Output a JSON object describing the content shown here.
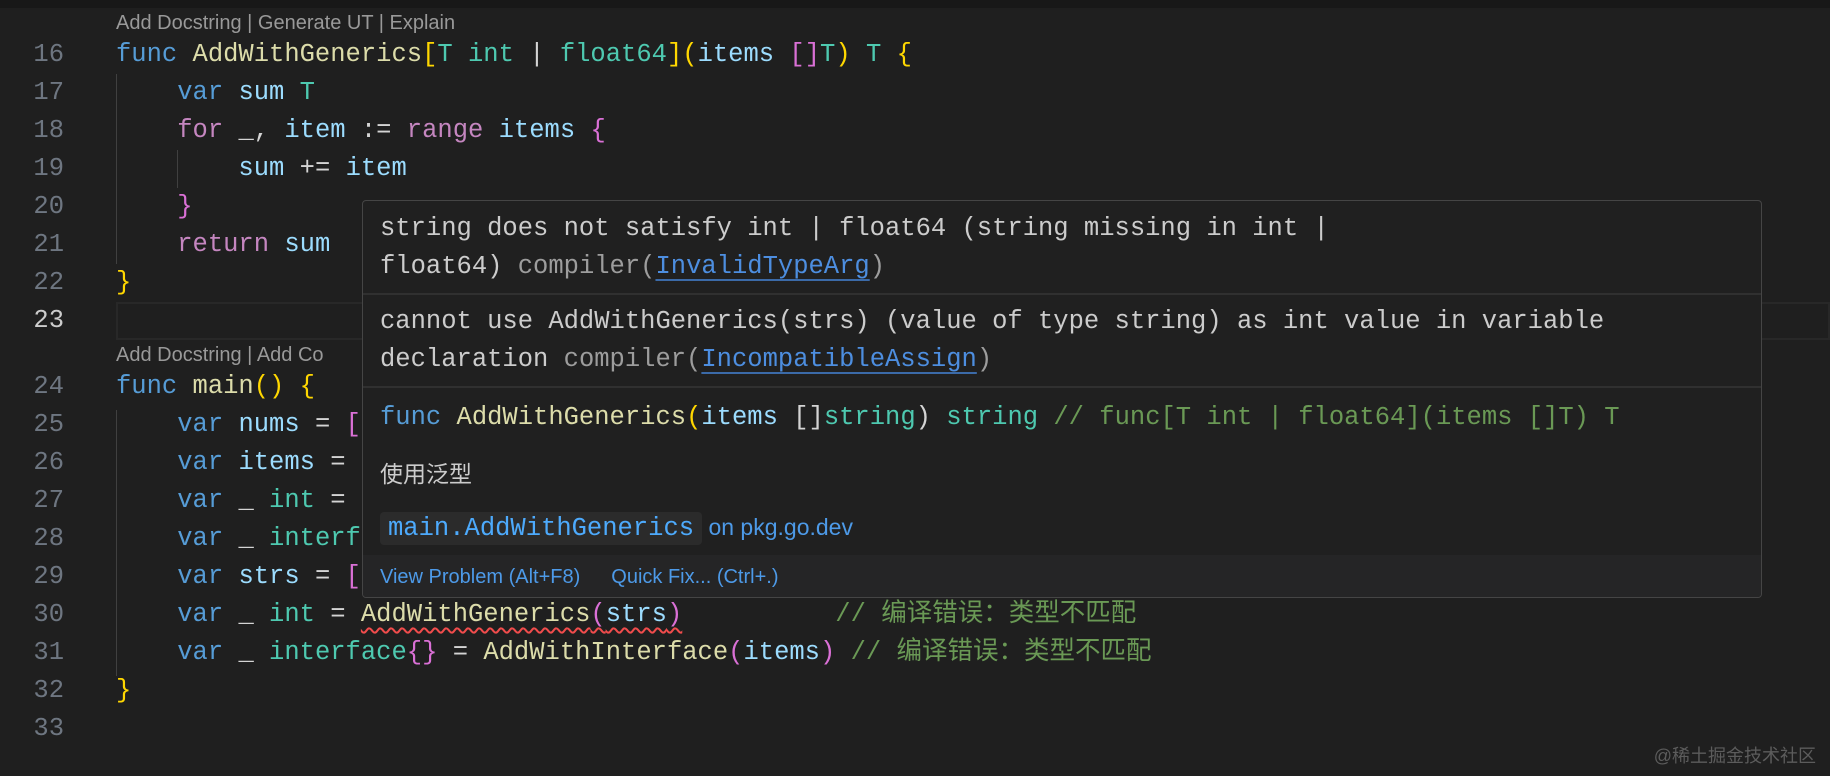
{
  "code": {
    "rows": [
      {
        "type": "lens",
        "text": "Add Docstring | Generate UT | Explain"
      },
      {
        "type": "line",
        "num": "16",
        "tokens": [
          [
            "func ",
            "kw"
          ],
          [
            "AddWithGenerics",
            "fn"
          ],
          [
            "[",
            "b1"
          ],
          [
            "T ",
            "ty"
          ],
          [
            "int",
            "ty"
          ],
          [
            " | ",
            "op"
          ],
          [
            "float64",
            "ty"
          ],
          [
            "]",
            "b1"
          ],
          [
            "(",
            "b1"
          ],
          [
            "items ",
            "var"
          ],
          [
            "[]",
            "b2"
          ],
          [
            "T",
            "ty"
          ],
          [
            ")",
            "b1"
          ],
          [
            " T ",
            "ty"
          ],
          [
            "{",
            "b1"
          ]
        ]
      },
      {
        "type": "line",
        "num": "17",
        "tokens": [
          [
            "    ",
            "pl"
          ],
          [
            "var ",
            "kw"
          ],
          [
            "sum ",
            "var"
          ],
          [
            "T",
            "ty"
          ]
        ]
      },
      {
        "type": "line",
        "num": "18",
        "tokens": [
          [
            "    ",
            "pl"
          ],
          [
            "for ",
            "ctl"
          ],
          [
            "_, ",
            "pl"
          ],
          [
            "item ",
            "var"
          ],
          [
            ":= ",
            "op"
          ],
          [
            "range ",
            "ctl"
          ],
          [
            "items ",
            "var"
          ],
          [
            "{",
            "b2"
          ]
        ]
      },
      {
        "type": "line",
        "num": "19",
        "tokens": [
          [
            "        ",
            "pl"
          ],
          [
            "sum ",
            "var"
          ],
          [
            "+= ",
            "op"
          ],
          [
            "item",
            "var"
          ]
        ]
      },
      {
        "type": "line",
        "num": "20",
        "tokens": [
          [
            "    ",
            "pl"
          ],
          [
            "}",
            "b2"
          ]
        ]
      },
      {
        "type": "line",
        "num": "21",
        "tokens": [
          [
            "    ",
            "pl"
          ],
          [
            "return ",
            "ctl"
          ],
          [
            "sum",
            "var"
          ]
        ]
      },
      {
        "type": "line",
        "num": "22",
        "tokens": [
          [
            "}",
            "b1"
          ]
        ]
      },
      {
        "type": "line",
        "num": "23",
        "current": true,
        "tokens": []
      },
      {
        "type": "lens",
        "text": "Add Docstring | Add Co"
      },
      {
        "type": "line",
        "num": "24",
        "tokens": [
          [
            "func ",
            "kw"
          ],
          [
            "main",
            "fn"
          ],
          [
            "()",
            "b1"
          ],
          [
            " ",
            "pl"
          ],
          [
            "{",
            "b1"
          ]
        ]
      },
      {
        "type": "line",
        "num": "25",
        "tokens": [
          [
            "    ",
            "pl"
          ],
          [
            "var ",
            "kw"
          ],
          [
            "nums ",
            "var"
          ],
          [
            "= ",
            "op"
          ],
          [
            "[",
            "b2"
          ]
        ]
      },
      {
        "type": "line",
        "num": "26",
        "tokens": [
          [
            "    ",
            "pl"
          ],
          [
            "var ",
            "kw"
          ],
          [
            "items ",
            "var"
          ],
          [
            "=",
            "op"
          ]
        ]
      },
      {
        "type": "line",
        "num": "27",
        "tokens": [
          [
            "    ",
            "pl"
          ],
          [
            "var ",
            "kw"
          ],
          [
            "_ ",
            "pl"
          ],
          [
            "int ",
            "ty"
          ],
          [
            "=",
            "op"
          ]
        ]
      },
      {
        "type": "line",
        "num": "28",
        "tokens": [
          [
            "    ",
            "pl"
          ],
          [
            "var ",
            "kw"
          ],
          [
            "_ ",
            "pl"
          ],
          [
            "interf",
            "ty"
          ]
        ]
      },
      {
        "type": "line",
        "num": "29",
        "tokens": [
          [
            "    ",
            "pl"
          ],
          [
            "var ",
            "kw"
          ],
          [
            "strs ",
            "var"
          ],
          [
            "= ",
            "op"
          ],
          [
            "[",
            "b2"
          ]
        ]
      },
      {
        "type": "line",
        "num": "30",
        "tokens": [
          [
            "    ",
            "pl"
          ],
          [
            "var ",
            "kw"
          ],
          [
            "_ ",
            "pl"
          ],
          [
            "int ",
            "ty"
          ],
          [
            "= ",
            "op"
          ],
          [
            "AddWithGenerics",
            "fn err"
          ],
          [
            "(",
            "b2 err"
          ],
          [
            "strs",
            "var err"
          ],
          [
            ")",
            "b2 err"
          ],
          [
            "          ",
            "pl"
          ],
          [
            "// 编译错误：类型不匹配",
            "cm"
          ]
        ]
      },
      {
        "type": "line",
        "num": "31",
        "tokens": [
          [
            "    ",
            "pl"
          ],
          [
            "var ",
            "kw"
          ],
          [
            "_ ",
            "pl"
          ],
          [
            "interface",
            "ty"
          ],
          [
            "{}",
            "b2"
          ],
          [
            " = ",
            "op"
          ],
          [
            "AddWithInterface",
            "fn"
          ],
          [
            "(",
            "b2"
          ],
          [
            "items",
            "var"
          ],
          [
            ")",
            "b2"
          ],
          [
            " // 编译错误：类型不匹配",
            "cm"
          ]
        ]
      },
      {
        "type": "line",
        "num": "32",
        "tokens": [
          [
            "}",
            "b1"
          ]
        ]
      },
      {
        "type": "line",
        "num": "33",
        "tokens": []
      }
    ]
  },
  "hover": {
    "problem1": {
      "line1": "string does not satisfy int | float64 (string missing in int |",
      "line2": "float64)",
      "source": "compiler(",
      "code": "InvalidTypeArg",
      "close": ")"
    },
    "problem2": {
      "line1": "cannot use AddWithGenerics(strs) (value of type string) as int value in variable",
      "line2": "declaration",
      "source": "compiler(",
      "code": "IncompatibleAssign",
      "close": ")"
    },
    "signature": {
      "kw": "func ",
      "name": "AddWithGenerics",
      "p1": "(",
      "param": "items ",
      "br": "[]",
      "ptype": "string",
      "p2": ") ",
      "ret": "string",
      "comment": " // func[T int | float64](items []T) T"
    },
    "doc": "使用泛型",
    "pkg_link": "main.AddWithGenerics",
    "pkg_suffix": " on pkg.go.dev",
    "actions": [
      "View Problem (Alt+F8)",
      "Quick Fix... (Ctrl+.)"
    ]
  },
  "watermark": "@稀土掘金技术社区",
  "colors": {
    "background": "#1f1f1f",
    "keyword": "#569cd6",
    "function": "#dcdcaa",
    "type": "#4ec9b0",
    "variable": "#9cdcfe",
    "comment": "#6a9955",
    "link": "#4d9ae8",
    "error": "#f14c4c"
  }
}
